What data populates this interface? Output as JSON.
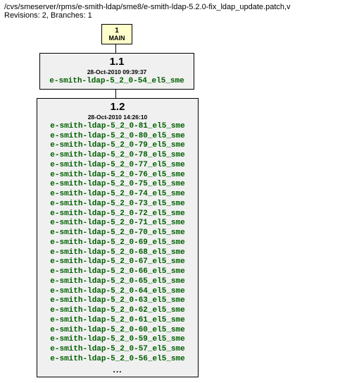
{
  "header": {
    "path": "/cvs/smeserver/rpms/e-smith-ldap/sme8/e-smith-ldap-5.2.0-fix_ldap_update.patch,v",
    "meta": "Revisions: 2, Branches: 1"
  },
  "branch": {
    "number": "1",
    "name": "MAIN"
  },
  "rev1": {
    "number": "1.1",
    "date": "28-Oct-2010 09:39:37",
    "tags": [
      "e-smith-ldap-5_2_0-54_el5_sme"
    ]
  },
  "rev2": {
    "number": "1.2",
    "date": "28-Oct-2010 14:26:10",
    "tags": [
      "e-smith-ldap-5_2_0-81_el5_sme",
      "e-smith-ldap-5_2_0-80_el5_sme",
      "e-smith-ldap-5_2_0-79_el5_sme",
      "e-smith-ldap-5_2_0-78_el5_sme",
      "e-smith-ldap-5_2_0-77_el5_sme",
      "e-smith-ldap-5_2_0-76_el5_sme",
      "e-smith-ldap-5_2_0-75_el5_sme",
      "e-smith-ldap-5_2_0-74_el5_sme",
      "e-smith-ldap-5_2_0-73_el5_sme",
      "e-smith-ldap-5_2_0-72_el5_sme",
      "e-smith-ldap-5_2_0-71_el5_sme",
      "e-smith-ldap-5_2_0-70_el5_sme",
      "e-smith-ldap-5_2_0-69_el5_sme",
      "e-smith-ldap-5_2_0-68_el5_sme",
      "e-smith-ldap-5_2_0-67_el5_sme",
      "e-smith-ldap-5_2_0-66_el5_sme",
      "e-smith-ldap-5_2_0-65_el5_sme",
      "e-smith-ldap-5_2_0-64_el5_sme",
      "e-smith-ldap-5_2_0-63_el5_sme",
      "e-smith-ldap-5_2_0-62_el5_sme",
      "e-smith-ldap-5_2_0-61_el5_sme",
      "e-smith-ldap-5_2_0-60_el5_sme",
      "e-smith-ldap-5_2_0-59_el5_sme",
      "e-smith-ldap-5_2_0-57_el5_sme",
      "e-smith-ldap-5_2_0-56_el5_sme"
    ],
    "ellipsis": "..."
  }
}
